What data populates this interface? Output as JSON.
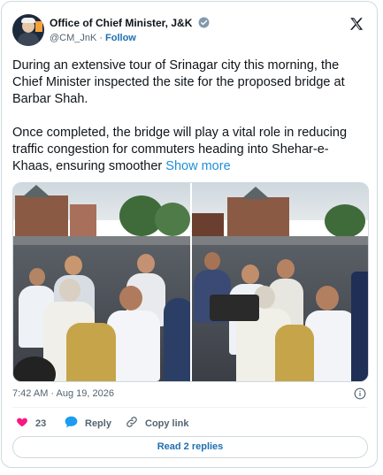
{
  "post": {
    "author_name": "Office of Chief Minister, J&K",
    "handle": "@CM_JnK",
    "separator": "·",
    "follow_label": "Follow",
    "paragraph_1": "During an extensive tour of Srinagar city this morning, the Chief Minister inspected the site for the proposed bridge at Barbar Shah.",
    "paragraph_2": "Once completed, the bridge will play a vital role in reducing traffic congestion for commuters heading into Shehar-e-Khaas, ensuring smoother",
    "show_more_label": "Show more",
    "timestamp": "7:42 AM · Aug 19, 2026"
  },
  "actions": {
    "like_count": "23",
    "reply_label": "Reply",
    "copy_link_label": "Copy link",
    "read_replies_label": "Read 2 replies"
  },
  "icons": {
    "verified": "verified-badge-icon",
    "x_logo": "x-logo-icon",
    "info": "info-icon",
    "like": "heart-icon",
    "reply": "speech-bubble-icon",
    "copy_link": "link-icon"
  },
  "colors": {
    "link_blue": "#1d6fb3",
    "heart_red": "#f91880",
    "reply_blue": "#1d9bf0",
    "muted_text": "#536471"
  }
}
